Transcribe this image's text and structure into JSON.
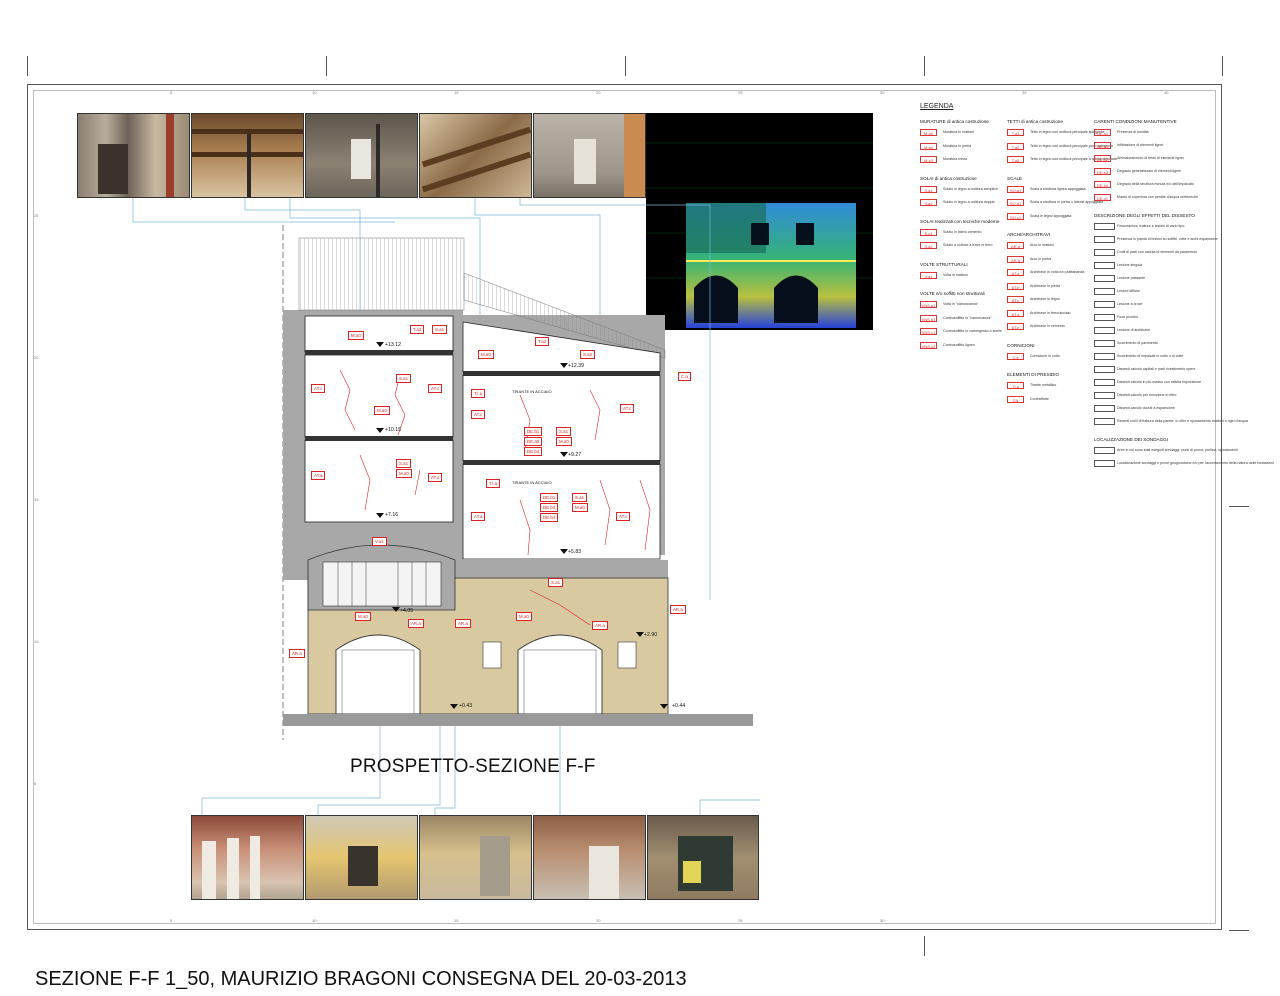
{
  "title": "PROSPETTO-SEZIONE F-F",
  "footer": "SEZIONE F-F 1_50, MAURIZIO BRAGONI CONSEGNA DEL 20-03-2013",
  "ruler_top": [
    "5",
    "10",
    "15",
    "20",
    "25",
    "30",
    "35",
    "40"
  ],
  "ruler_bottom": [
    "5",
    "10",
    "15",
    "20",
    "25",
    "30"
  ],
  "ruler_left": [
    "25",
    "20",
    "15",
    "10",
    "5"
  ],
  "levels": [
    "+13.12",
    "+12.39",
    "+10.15",
    "+9.27",
    "+7.16",
    "+5.83",
    "+4.05",
    "+2.90",
    "+0.43",
    "+0.44"
  ],
  "tie_rod_labels": [
    "TIRANTE IN ACCIAIO",
    "TIRANTE IN ACCIAIO"
  ],
  "section_labels": [
    "M.a0",
    "T.a2",
    "S.a1",
    "T.a2",
    "S.a2",
    "M.a0",
    "C.a",
    "AT.c",
    "S.a1",
    "AT.c",
    "M.a0",
    "T.l.a",
    "AT.c",
    "AT.c",
    "DE.b1",
    "DE.a0",
    "DE.b4",
    "S.a1",
    "M.a0",
    "S.a1",
    "AT.a",
    "M.a0",
    "AT.c",
    "T.l.a",
    "DE.b1",
    "DE.b3",
    "DE.b4",
    "S.a1",
    "M.a0",
    "AT.a",
    "AT.c",
    "V.a1",
    "S.a1",
    "M.a0",
    "AR.a",
    "AR.a",
    "M.a0",
    "AR.a",
    "AR.a",
    "AR.a"
  ],
  "legend": {
    "title": "LEGENDA",
    "col1": [
      {
        "heading": "MURATURE di antica costruzione",
        "items": [
          [
            "M.a0",
            "Muratura in mattoni"
          ],
          [
            "M.a0",
            "Muratura in pietra"
          ],
          [
            "M.c0",
            "Muratura mista"
          ]
        ]
      },
      {
        "heading": "SOLAI di antica costruzione",
        "items": [
          [
            "S.a1",
            "Solaio in legno a orditura semplice"
          ],
          [
            "S.a2",
            "Solaio in legno a orditura doppia"
          ]
        ]
      },
      {
        "heading": "SOLAI realizzati con tecniche moderne",
        "items": [
          [
            "S.c1",
            "Solaio in latero cemento"
          ],
          [
            "S.a2",
            "Solaio a coltrice a trave in ferro"
          ]
        ]
      },
      {
        "heading": "VOLTE STRUTTURALI",
        "items": [
          [
            "V.a1",
            "Volta in mattoni"
          ]
        ]
      },
      {
        "heading": "VOLTE e/o soffitti non strutturali",
        "items": [
          [
            "VNS.a1",
            "Volta in \"camorcanna\""
          ],
          [
            "VNS.b1",
            "Controsoffitto in \"camorcanna\""
          ],
          [
            "VNS.c1",
            "Controsoffitto in cartongesso o simile"
          ],
          [
            "VNS.c2",
            "Controsoffitto ligneo"
          ]
        ]
      }
    ],
    "col2": [
      {
        "heading": "TETTI di antica costruzione",
        "items": [
          [
            "T.a1",
            "Tetto in legno con orditura principale spingente"
          ],
          [
            "T.a2",
            "Tetto in legno con orditura principale poco spingente"
          ],
          [
            "T.a3",
            "Tetto in legno con orditura principale a spinta eliminata"
          ]
        ]
      },
      {
        "heading": "SCALE",
        "items": [
          [
            "SO.a1",
            "Scala a struttura lignea appoggiata"
          ],
          [
            "SO.b1",
            "Scala a struttura in pietra o laterizi appoggiata"
          ],
          [
            "SO.c1",
            "Scala in legno appoggiata"
          ]
        ]
      },
      {
        "heading": "ARCHI/ARCHITRAVI",
        "items": [
          [
            "AR.a",
            "Arco in mattoni"
          ],
          [
            "AR.b",
            "Arco in pietra"
          ],
          [
            "AT.a",
            "Architrave in volta e/o piattabanda"
          ],
          [
            "AT.b",
            "Architrave in pietra"
          ],
          [
            "AT.c",
            "Architrave in legno"
          ],
          [
            "AT.d",
            "Architrave in ferro/acciaio"
          ],
          [
            "AT.e",
            "Architrave in cemento"
          ]
        ]
      },
      {
        "heading": "CORNICIONI",
        "items": [
          [
            "C.a",
            "Cornicione in cotto"
          ]
        ]
      },
      {
        "heading": "ELEMENTI DI PRESIDIO",
        "items": [
          [
            "TI.a",
            "Tirante metallico"
          ],
          [
            "CN",
            "Contrafforte"
          ]
        ]
      }
    ],
    "col3": [
      {
        "heading": "CARENTI CONDIZIONI MANUTENTIVE",
        "items": [
          [
            "DE.a1",
            "Presenza di umidità"
          ],
          [
            "DE.b1",
            "Infiltrazione di elementi lignei"
          ],
          [
            "DE.b2",
            "Ammaloramento di teste di elementi lignei"
          ],
          [
            "DE.b3",
            "Degrado generalizzato di elementi lignei"
          ],
          [
            "DE.b4",
            "Degrado della struttura minuta e/o dell'impalcato"
          ],
          [
            "DE.c1",
            "Manto di copertura con perdite d'acqua meteoriche"
          ]
        ]
      },
      {
        "heading": "DESCRIZIONE DEGLI EFFETTI DEL DISSESTO",
        "items": [
          [
            "",
            "Fessurazioni, fratture e lesioni di vario tipo"
          ],
          [
            "",
            "Presenza in pianta di lesioni su soffitti, volte e archi espansione"
          ],
          [
            "",
            "Crolli di parti con caduta di elementi da paramento"
          ],
          [
            "",
            "Lesione singola"
          ],
          [
            "",
            "Lesione passante"
          ],
          [
            "",
            "Lesioni diffuse"
          ],
          [
            "",
            "Lesione a croce"
          ],
          [
            "",
            "Fuori piombo"
          ],
          [
            "",
            "Lesione di architrave"
          ],
          [
            "",
            "Scorrimento di pavimento"
          ],
          [
            "",
            "Scorrimento di impalcati in cotto o di volte"
          ],
          [
            "",
            "Dissesti calcolo capitali e parti rivestimento opere"
          ],
          [
            "",
            "Dissesti calcolo in più masso con attività esposizione"
          ],
          [
            "",
            "Dissesti calcolo per rimozione in ritiro"
          ],
          [
            "",
            "Dissesti calcolo dovuti a espansione"
          ],
          [
            "",
            "Recenti crolli di frattura della parete, in ritiro e spostamento mattoni o rigiri d'acqua"
          ]
        ]
      },
      {
        "heading": "LOCALIZZAZIONE DEI SONDAGGI",
        "items": [
          [
            "",
            "Aree in cui sono stati eseguiti sondaggi, punti di prova, prelievi, spostamenti"
          ],
          [
            "",
            "Localizzazione sondaggi e prove geognostiche e/o per l'accertamento della natura delle fondazioni"
          ]
        ]
      }
    ]
  },
  "colors": {
    "accent": "#d22222",
    "facade": "#d9c9a1",
    "scan_bg": "#000000"
  }
}
